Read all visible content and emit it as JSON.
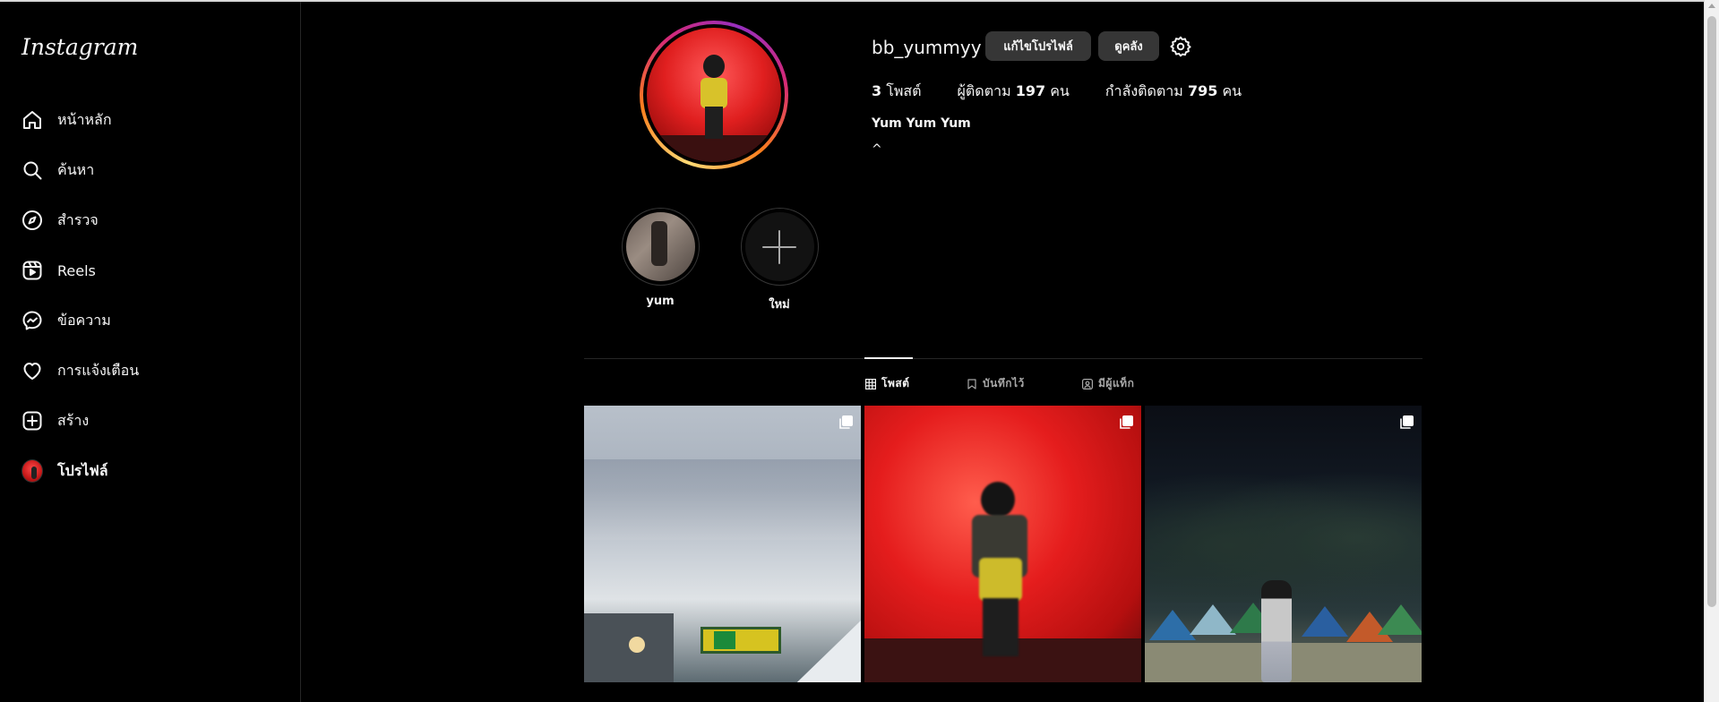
{
  "sidebar": {
    "logo": "Instagram",
    "items": [
      {
        "label": "หน้าหลัก",
        "icon": "home-icon"
      },
      {
        "label": "ค้นหา",
        "icon": "search-icon"
      },
      {
        "label": "สำรวจ",
        "icon": "explore-icon"
      },
      {
        "label": "Reels",
        "icon": "reels-icon"
      },
      {
        "label": "ข้อความ",
        "icon": "messenger-icon"
      },
      {
        "label": "การแจ้งเตือน",
        "icon": "heart-icon"
      },
      {
        "label": "สร้าง",
        "icon": "create-icon"
      },
      {
        "label": "โปรไฟล์",
        "icon": "profile-avatar"
      }
    ]
  },
  "profile": {
    "username": "bb_yummyy",
    "edit_button": "แก้ไขโปรไฟล์",
    "archive_button": "ดูคลัง",
    "settings_icon": "gear-icon",
    "stats": {
      "posts_count": "3",
      "posts_label": "โพสต์",
      "followers_label": "ผู้ติดตาม",
      "followers_count": "197",
      "followers_unit": "คน",
      "following_label": "กำลังติดตาม",
      "following_count": "795",
      "following_unit": "คน"
    },
    "bio_name": "Yum Yum Yum",
    "bio_text": "^"
  },
  "highlights": [
    {
      "label": "yum"
    },
    {
      "label": "ใหม่"
    }
  ],
  "tabs": {
    "posts": "โพสต์",
    "saved": "บันทึกไว้",
    "tagged": "มีผู้แท็ก",
    "active": "posts"
  },
  "posts": [
    {
      "type": "multi-image",
      "icon": "carousel-icon"
    },
    {
      "type": "multi-image",
      "icon": "carousel-icon"
    },
    {
      "type": "multi-image",
      "icon": "carousel-icon"
    }
  ],
  "colors": {
    "background": "#000000",
    "text": "#f5f5f5",
    "button_bg": "#363636",
    "muted": "#a8a8a8",
    "divider": "#262626"
  }
}
